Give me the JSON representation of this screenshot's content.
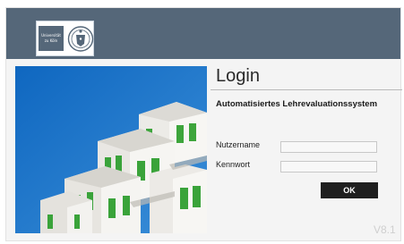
{
  "header": {
    "logo": {
      "wordmark_line1": "Universität",
      "wordmark_line2": "zu Köln"
    }
  },
  "login": {
    "title": "Login",
    "subtitle": "Automatisiertes Lehrevaluationssystem",
    "username_label": "Nutzername",
    "username_value": "",
    "password_label": "Kennwort",
    "password_value": "",
    "ok_label": "OK"
  },
  "version": "V8.1",
  "colors": {
    "header_bg": "#556779",
    "button_bg": "#1f1f1f",
    "sky": "#1f74c6",
    "building_wall": "#f0eeeb",
    "window_green": "#39a33a"
  }
}
